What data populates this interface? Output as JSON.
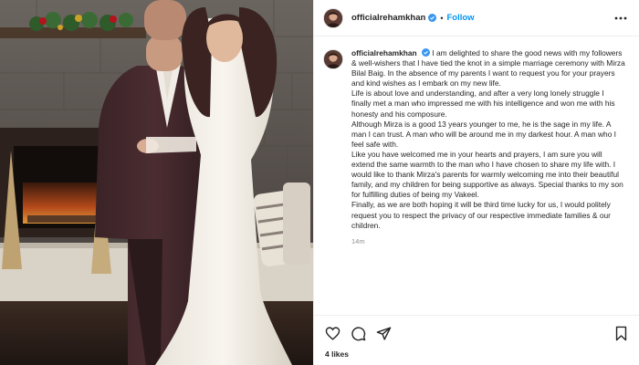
{
  "post": {
    "username": "officialrehamkhan",
    "follow_label": "Follow",
    "separator": "•",
    "caption": [
      "I am delighted to share the good news with my followers & well-wishers that I have tied the knot in a simple marriage ceremony with Mirza Bilal Baig. In the absence of my parents I want to request you for your prayers and kind wishes as I embark on my new life.",
      "Life is about love and understanding, and after a very long lonely struggle I finally met a man who impressed me with his intelligence and won me with his honesty and his composure.",
      "Although Mirza is a good 13 years younger to me, he is the sage in my life. A man I can trust. A man who will be around me in my darkest hour. A man who I feel safe with.",
      "Like you have welcomed me in your hearts and prayers, I am sure you will extend the same warmth to the man who I have chosen to share my life with. I would like to thank Mirza's parents for warmly welcoming me into their beautiful family, and my children for being supportive as always. Special thanks to my son for fulfilling duties of being my Vakeel.",
      "Finally, as we are both hoping it will be third time lucky for us, I would politely request you to respect the privacy of our respective immediate families & our children."
    ],
    "time_ago": "14m",
    "likes": "4 likes"
  },
  "icons": {
    "like": "heart-icon",
    "comment": "comment-icon",
    "share": "paper-plane-icon",
    "save": "bookmark-icon",
    "more": "more-horizontal-icon",
    "verified": "verified-badge-icon"
  },
  "colors": {
    "link_blue": "#0095f6",
    "verified_blue": "#3897f0",
    "muted": "#8e8e8e",
    "text": "#262626"
  }
}
